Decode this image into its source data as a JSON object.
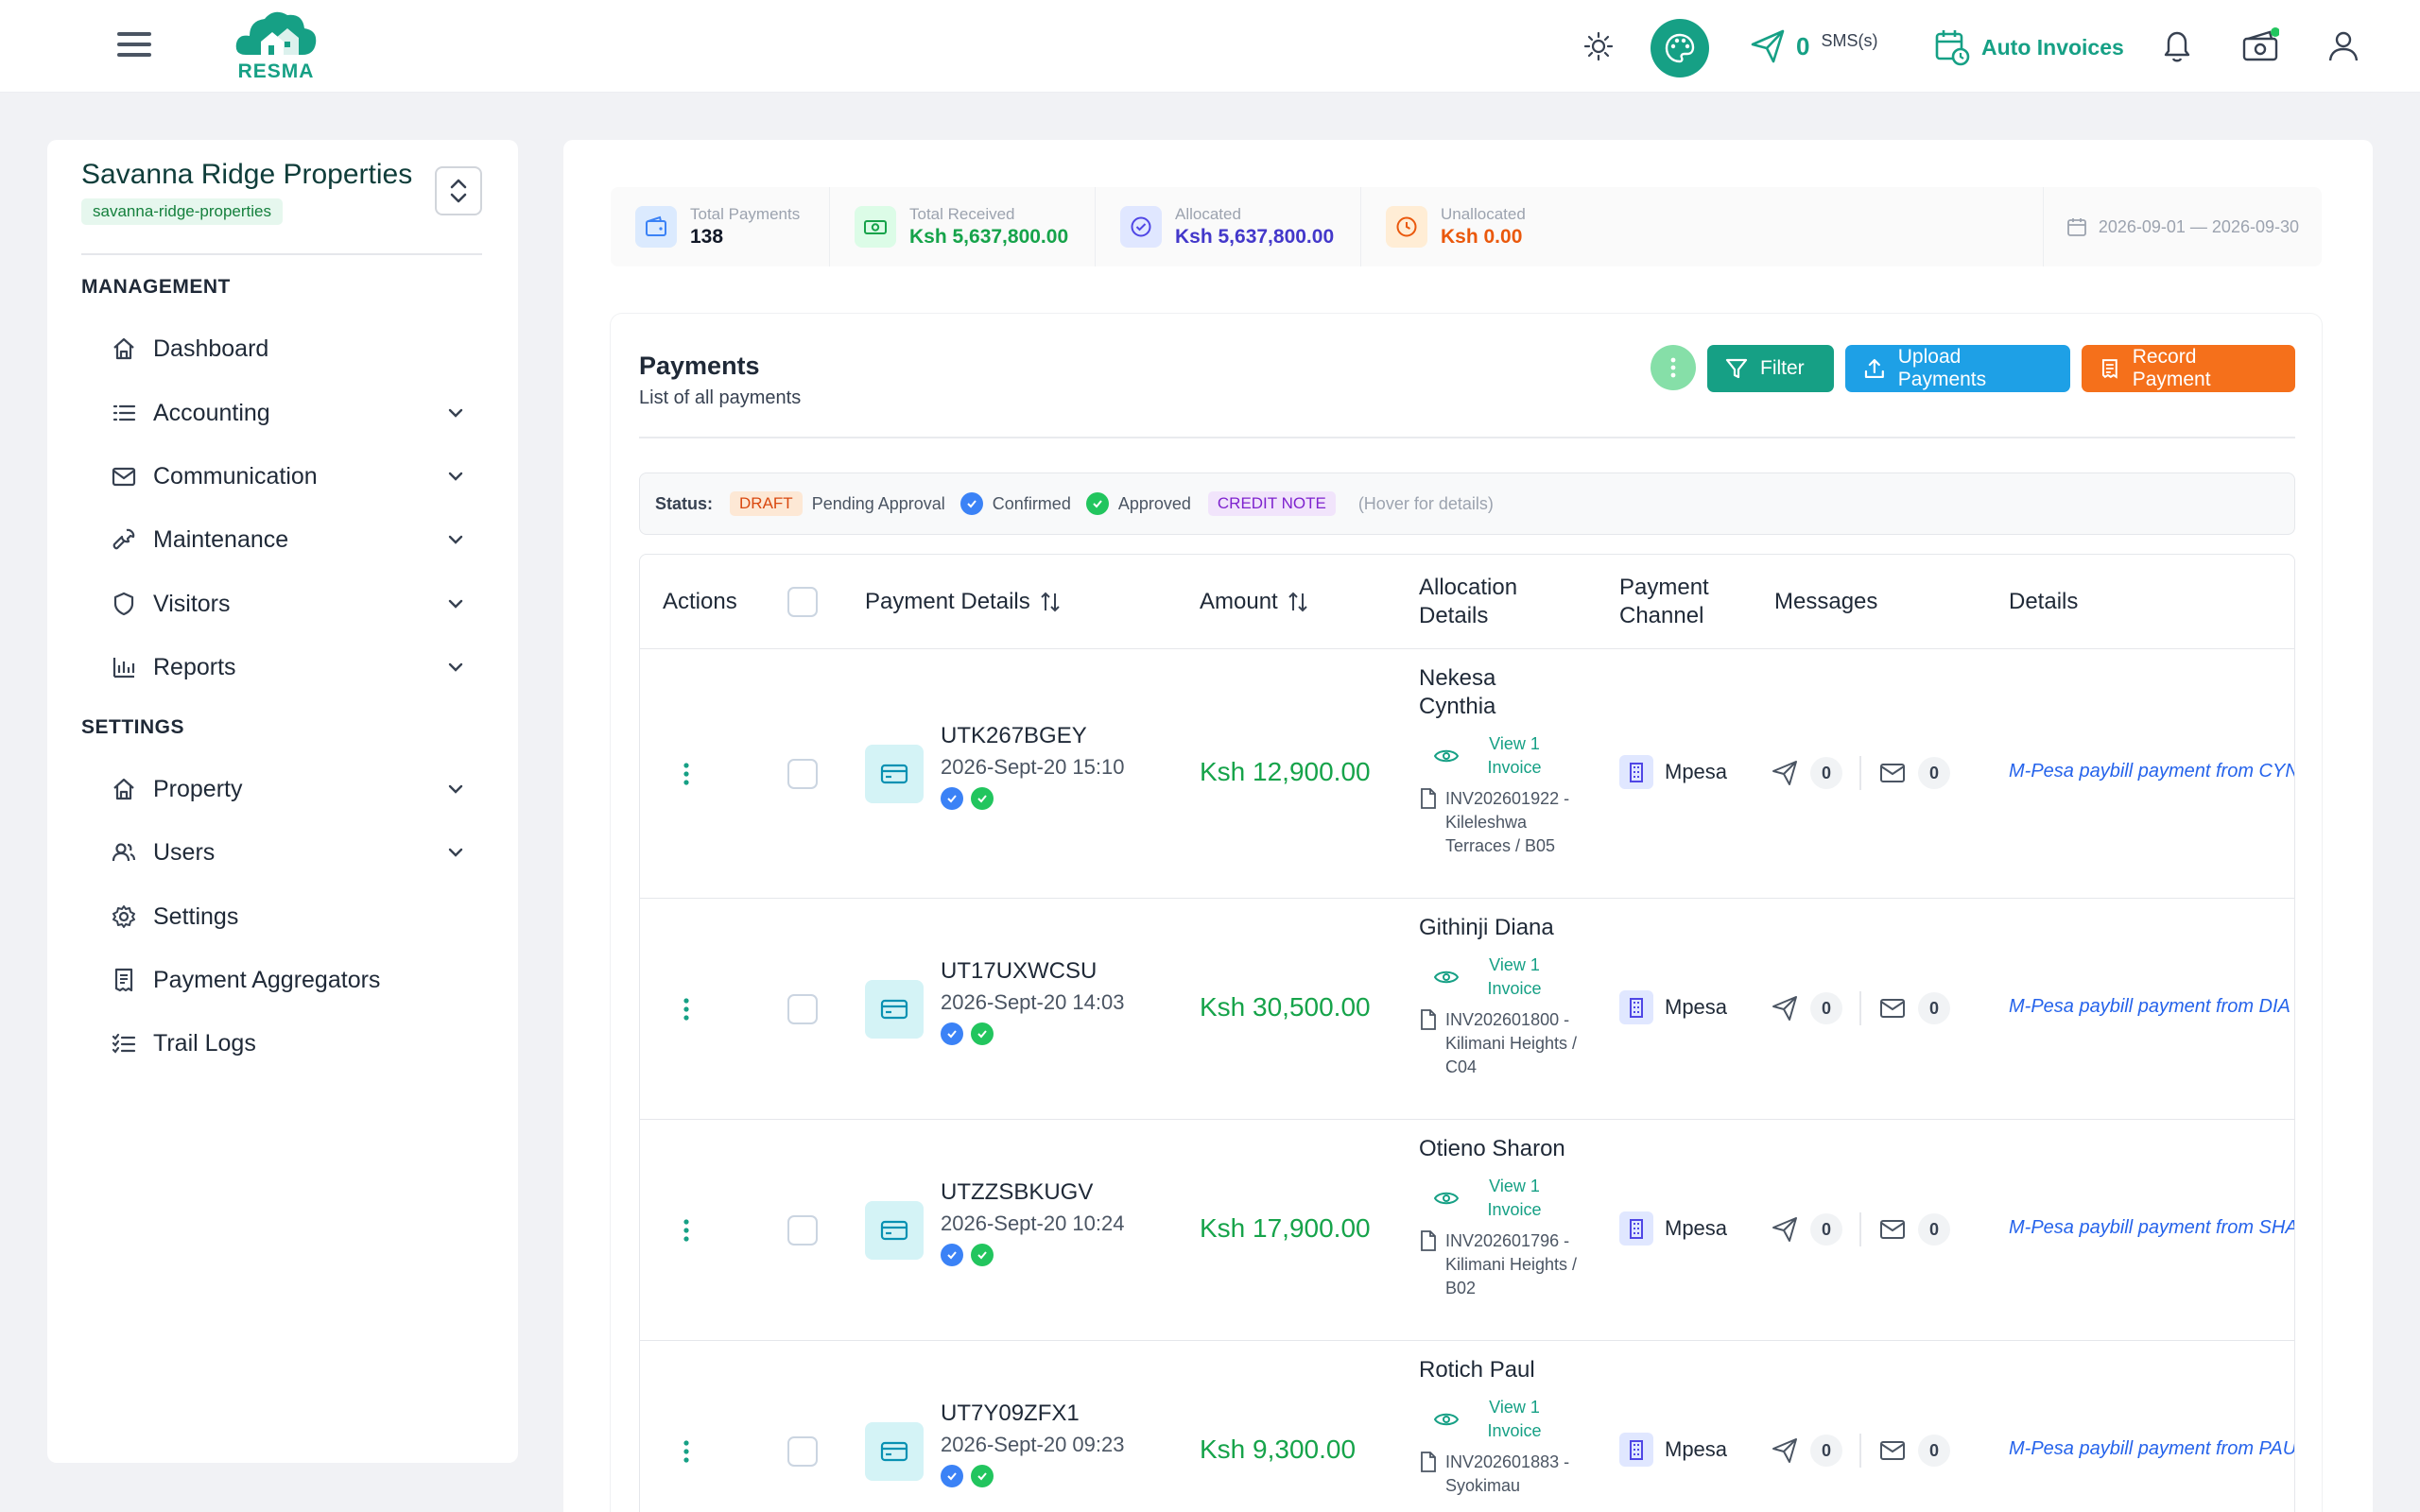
{
  "topbar": {
    "logo_text": "RESMA",
    "sms_count": "0",
    "sms_unit": "SMS(s)",
    "auto_invoices": "Auto Invoices"
  },
  "sidebar": {
    "property_name": "Savanna Ridge Properties",
    "property_slug": "savanna-ridge-properties",
    "management_heading": "MANAGEMENT",
    "settings_heading": "SETTINGS",
    "management_items": [
      {
        "label": "Dashboard",
        "icon": "home-icon",
        "expandable": false
      },
      {
        "label": "Accounting",
        "icon": "list-icon",
        "expandable": true
      },
      {
        "label": "Communication",
        "icon": "mail-icon",
        "expandable": true
      },
      {
        "label": "Maintenance",
        "icon": "wrench-icon",
        "expandable": true
      },
      {
        "label": "Visitors",
        "icon": "shield-icon",
        "expandable": true
      },
      {
        "label": "Reports",
        "icon": "bar-chart-icon",
        "expandable": true
      }
    ],
    "settings_items": [
      {
        "label": "Property",
        "icon": "home-icon",
        "expandable": true
      },
      {
        "label": "Users",
        "icon": "users-icon",
        "expandable": true
      },
      {
        "label": "Settings",
        "icon": "gear-icon",
        "expandable": false
      },
      {
        "label": "Payment Aggregators",
        "icon": "receipt-icon",
        "expandable": false
      },
      {
        "label": "Trail Logs",
        "icon": "checklist-icon",
        "expandable": false
      }
    ]
  },
  "stats": {
    "total_payments_label": "Total Payments",
    "total_payments_value": "138",
    "total_received_label": "Total Received",
    "total_received_value": "Ksh 5,637,800.00",
    "allocated_label": "Allocated",
    "allocated_value": "Ksh 5,637,800.00",
    "unallocated_label": "Unallocated",
    "unallocated_value": "Ksh 0.00",
    "date_range": "2026-09-01 — 2026-09-30"
  },
  "payments": {
    "title": "Payments",
    "subtitle": "List of all payments",
    "filter_label": "Filter",
    "upload_label": "Upload Payments",
    "record_label": "Record Payment"
  },
  "legend": {
    "status_label": "Status:",
    "draft": "DRAFT",
    "pending": "Pending Approval",
    "confirmed": "Confirmed",
    "approved": "Approved",
    "credit_note": "CREDIT NOTE",
    "hint": "(Hover for details)"
  },
  "table": {
    "headers": {
      "actions": "Actions",
      "payment_details": "Payment Details",
      "amount": "Amount",
      "allocation_line1": "Allocation",
      "allocation_line2": "Details",
      "channel_line1": "Payment",
      "channel_line2": "Channel",
      "messages": "Messages",
      "details": "Details"
    },
    "rows": [
      {
        "ref": "UTK267BGEY",
        "datetime": "2026-Sept-20 15:10",
        "amount": "Ksh 12,900.00",
        "tenant": "Nekesa Cynthia",
        "view_invoice": "View 1 Invoice",
        "invoice": "INV202601922 - Kileleshwa Terraces / B05",
        "channel": "Mpesa",
        "sms_count": "0",
        "email_count": "0",
        "detail": "M-Pesa paybill payment from CYN"
      },
      {
        "ref": "UT17UXWCSU",
        "datetime": "2026-Sept-20 14:03",
        "amount": "Ksh 30,500.00",
        "tenant": "Githinji Diana",
        "view_invoice": "View 1 Invoice",
        "invoice": "INV202601800 - Kilimani Heights / C04",
        "channel": "Mpesa",
        "sms_count": "0",
        "email_count": "0",
        "detail": "M-Pesa paybill payment from DIA"
      },
      {
        "ref": "UTZZSBKUGV",
        "datetime": "2026-Sept-20 10:24",
        "amount": "Ksh 17,900.00",
        "tenant": "Otieno Sharon",
        "view_invoice": "View 1 Invoice",
        "invoice": "INV202601796 - Kilimani Heights / B02",
        "channel": "Mpesa",
        "sms_count": "0",
        "email_count": "0",
        "detail": "M-Pesa paybill payment from SHA"
      },
      {
        "ref": "UT7Y09ZFX1",
        "datetime": "2026-Sept-20 09:23",
        "amount": "Ksh 9,300.00",
        "tenant": "Rotich Paul",
        "view_invoice": "View 1 Invoice",
        "invoice": "INV202601883 - Syokimau",
        "channel": "Mpesa",
        "sms_count": "0",
        "email_count": "0",
        "detail": "M-Pesa paybill payment from PAU"
      }
    ]
  },
  "colors": {
    "brand_green": "#16a085",
    "amount_green": "#16a34a",
    "upload_blue": "#1ea0e6",
    "record_orange": "#f5701b",
    "confirmed_blue": "#3b82f6",
    "approved_green": "#22c55e"
  }
}
